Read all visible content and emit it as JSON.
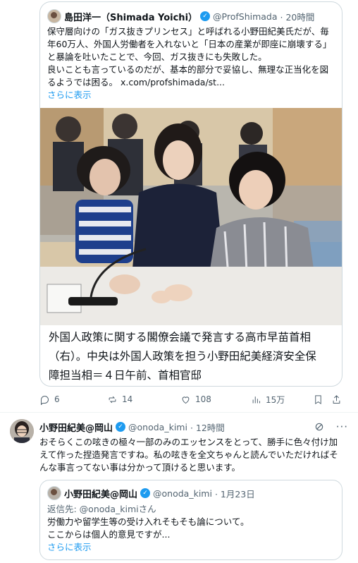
{
  "quoted": {
    "name": "島田洋一（Shimada Yoichi）",
    "handle": "@ProfShimada",
    "time": "· 20時間",
    "text_lines": [
      "保守層向けの「ガス抜きプリンセス」と呼ばれる小野田紀美氏だが、毎",
      "年60万人、外国人労働者を入れないと「日本の産業が即座に崩壊する」",
      "と暴論を吐いたことで、今回、ガス抜きにも失敗した。",
      "良いことも言っているのだが、基本的部分で妥協し、無理な正当化を図",
      "るようでは困る。 x.com/profshimada/st..."
    ],
    "show_more": "さらに表示",
    "caption_lines": [
      "外国人政策に関する閣僚会議で発言する高市早苗首相",
      "（右）。中央は外国人政策を担う小野田紀美経済安全保",
      "障担当相＝４日午前、首相官邸"
    ]
  },
  "actions": {
    "replies": "6",
    "reposts": "14",
    "likes": "108",
    "views": "15万"
  },
  "reply": {
    "name": "小野田紀美@岡山",
    "handle": "@onoda_kimi",
    "time": "· 12時間",
    "text_lines": [
      "おそらくこの呟きの極々一部のみのエッセンスをとって、勝手に色々付け加",
      "えて作った捏造発言ですね。私の呟きを全文ちゃんと読んでいただければそ",
      "んな事言ってない事は分かって頂けると思います。"
    ],
    "inner": {
      "name": "小野田紀美@岡山",
      "handle": "@onoda_kimi",
      "time": "· 1月23日",
      "reply_to": "返信先: @onoda_kimiさん",
      "lines": [
        "労働力や留学生等の受け入れそもそも論について。",
        "ここからは個人的意見ですが..."
      ],
      "show_more": "さらに表示"
    }
  },
  "colors": {
    "accent": "#1d9bf0",
    "muted": "#536471",
    "border": "#cfd9de"
  }
}
